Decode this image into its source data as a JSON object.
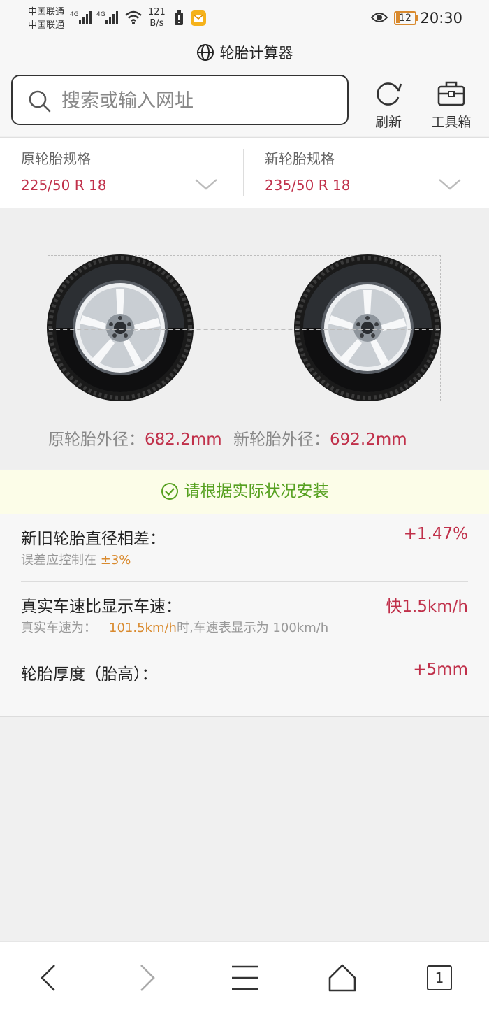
{
  "status_bar": {
    "carrier1": "中国联通",
    "carrier2": "中国联通",
    "net1": "4G",
    "net2": "4G",
    "speed_value": "121",
    "speed_unit": "B/s",
    "battery": "12",
    "time": "20:30"
  },
  "page_title": "轮胎计算器",
  "search": {
    "placeholder": "搜索或输入网址"
  },
  "toolbar": {
    "refresh_label": "刷新",
    "toolbox_label": "工具箱"
  },
  "specs": {
    "original": {
      "label": "原轮胎规格",
      "value": "225/50 R 18"
    },
    "new": {
      "label": "新轮胎规格",
      "value": "235/50 R 18"
    }
  },
  "diameters": {
    "original_label": "原轮胎外径：",
    "original_value": "682.2mm",
    "new_label": "新轮胎外径：",
    "new_value": "692.2mm"
  },
  "notice": "请根据实际状况安装",
  "results": {
    "diameter_diff": {
      "label": "新旧轮胎直径相差：",
      "value": "+1.47%",
      "sub_prefix": "误差应控制在",
      "sub_highlight": "±3%"
    },
    "speed": {
      "label": "真实车速比显示车速：",
      "value": "快1.5km/h",
      "sub_prefix": "真实车速为：",
      "sub_highlight": "101.5km/h",
      "sub_suffix": "时,车速表显示为 100km/h"
    },
    "thickness": {
      "label": "轮胎厚度（胎高）：",
      "value": "+5mm"
    }
  },
  "bottom_nav": {
    "tab_count": "1"
  },
  "colors": {
    "accent_red": "#c0304a",
    "highlight_orange": "#d98a2e",
    "notice_green": "#55a01f"
  }
}
